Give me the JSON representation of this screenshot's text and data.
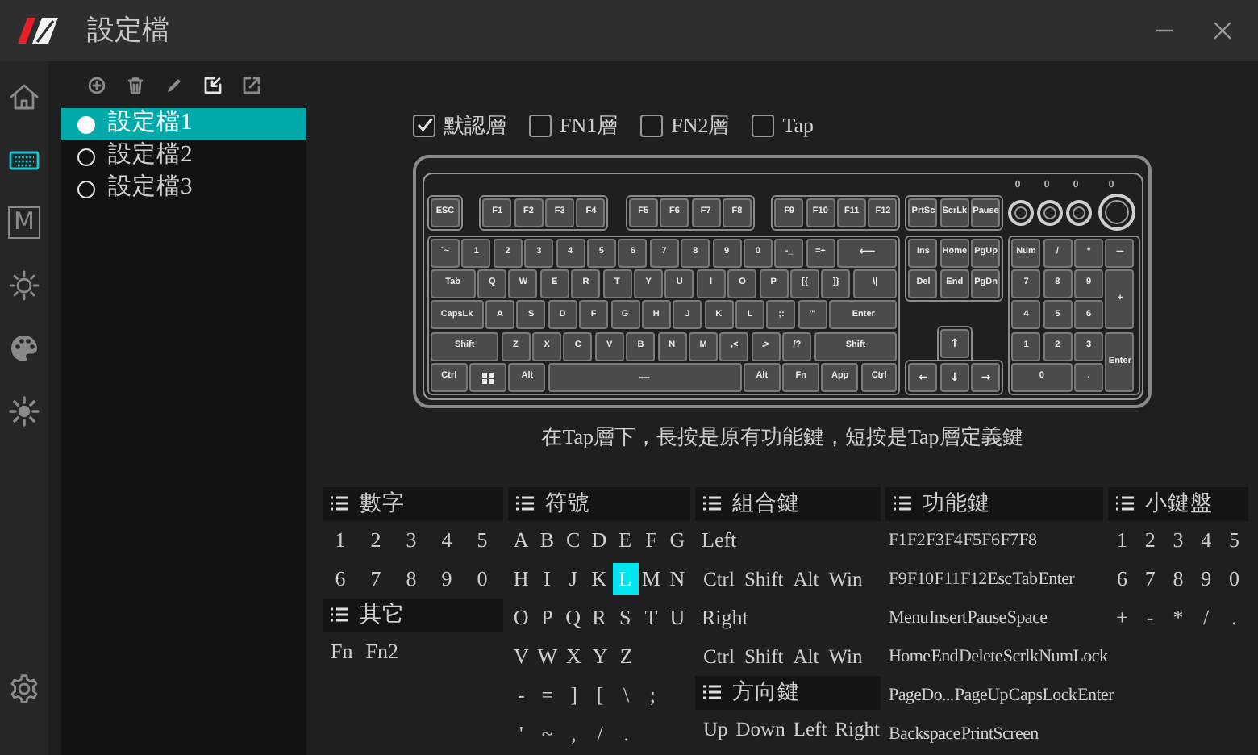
{
  "window": {
    "title": "設定檔"
  },
  "sidebar": {
    "items": [
      {
        "selected": false
      },
      {
        "selected": true
      },
      {
        "glyph": "M",
        "selected": false
      },
      {
        "selected": false
      },
      {
        "selected": false
      },
      {
        "selected": false
      },
      {
        "selected": false
      }
    ]
  },
  "profiles": [
    {
      "label": "設定檔1",
      "selected": true
    },
    {
      "label": "設定檔2",
      "selected": false
    },
    {
      "label": "設定檔3",
      "selected": false
    }
  ],
  "layers": [
    {
      "label": "默認層",
      "checked": true
    },
    {
      "label": "FN1層",
      "checked": false
    },
    {
      "label": "FN2層",
      "checked": false
    },
    {
      "label": "Tap",
      "checked": false
    }
  ],
  "keyboard": {
    "knob_readings": [
      "0",
      "0",
      "0",
      "0"
    ],
    "function_row": [
      [
        "ESC"
      ],
      [
        "F1",
        "F2",
        "F3",
        "F4"
      ],
      [
        "F5",
        "F6",
        "F7",
        "F8"
      ],
      [
        "F9",
        "F10",
        "F11",
        "F12"
      ]
    ],
    "nav_top": [
      "PrtSc",
      "ScrLk",
      "Pause"
    ],
    "main_rows": [
      [
        "`~",
        "1",
        "2",
        "3",
        "4",
        "5",
        "6",
        "7",
        "8",
        "9",
        "0",
        "-_",
        "=+",
        "⟵"
      ],
      [
        "Tab",
        "Q",
        "W",
        "E",
        "R",
        "T",
        "Y",
        "U",
        "I",
        "O",
        "P",
        "[{",
        "]}",
        "\\|"
      ],
      [
        "CapsLk",
        "A",
        "S",
        "D",
        "F",
        "G",
        "H",
        "J",
        "K",
        "L",
        ";:",
        "'\"",
        "Enter"
      ],
      [
        "Shift",
        "Z",
        "X",
        "C",
        "V",
        "B",
        "N",
        "M",
        ",<",
        ".>",
        "/?",
        "Shift"
      ],
      [
        "Ctrl",
        {
          "kind": "logo"
        },
        "Alt",
        "—",
        "Alt",
        "Fn",
        "App",
        "Ctrl"
      ]
    ],
    "nav": [
      [
        "Ins",
        "Home",
        "PgUp"
      ],
      [
        "Del",
        "End",
        "PgDn"
      ]
    ],
    "arrows": [
      "↑",
      "←",
      "↓",
      "→"
    ],
    "numpad": [
      "Num",
      "/",
      "*",
      "−",
      "7",
      "8",
      "9",
      "+",
      "4",
      "5",
      "6",
      "1",
      "2",
      "3",
      "Enter",
      "0",
      "."
    ]
  },
  "hint": "在Tap層下，長按是原有功能鍵，短按是Tap層定義鍵",
  "palettes": [
    {
      "title": "數字",
      "rows": [
        {
          "kind": "keys",
          "items": [
            {
              "label": "1",
              "selected": false
            },
            {
              "label": "2",
              "selected": false
            },
            {
              "label": "3",
              "selected": false
            },
            {
              "label": "4",
              "selected": false
            },
            {
              "label": "5",
              "selected": false
            }
          ]
        },
        {
          "kind": "keys",
          "items": [
            {
              "label": "6",
              "selected": false
            },
            {
              "label": "7",
              "selected": false
            },
            {
              "label": "8",
              "selected": false
            },
            {
              "label": "9",
              "selected": false
            },
            {
              "label": "0",
              "selected": false
            }
          ]
        }
      ]
    },
    {
      "title": "其它",
      "rows": [
        {
          "kind": "keys",
          "items": [
            {
              "label": "Fn",
              "selected": false
            },
            {
              "label": "Fn2",
              "selected": false
            }
          ]
        }
      ]
    },
    {
      "title": "符號",
      "rows": [
        {
          "kind": "keys",
          "items": [
            {
              "label": "A",
              "selected": false
            },
            {
              "label": "B",
              "selected": false
            },
            {
              "label": "C",
              "selected": false
            },
            {
              "label": "D",
              "selected": false
            },
            {
              "label": "E",
              "selected": false
            },
            {
              "label": "F",
              "selected": false
            },
            {
              "label": "G",
              "selected": false
            }
          ]
        },
        {
          "kind": "keys",
          "items": [
            {
              "label": "H",
              "selected": false
            },
            {
              "label": "I",
              "selected": false
            },
            {
              "label": "J",
              "selected": false
            },
            {
              "label": "K",
              "selected": false
            },
            {
              "label": "L",
              "selected": true
            },
            {
              "label": "M",
              "selected": false
            },
            {
              "label": "N",
              "selected": false
            }
          ]
        },
        {
          "kind": "keys",
          "items": [
            {
              "label": "O",
              "selected": false
            },
            {
              "label": "P",
              "selected": false
            },
            {
              "label": "Q",
              "selected": false
            },
            {
              "label": "R",
              "selected": false
            },
            {
              "label": "S",
              "selected": false
            },
            {
              "label": "T",
              "selected": false
            },
            {
              "label": "U",
              "selected": false
            }
          ]
        },
        {
          "kind": "keys",
          "items": [
            {
              "label": "V",
              "selected": false
            },
            {
              "label": "W",
              "selected": false
            },
            {
              "label": "X",
              "selected": false
            },
            {
              "label": "Y",
              "selected": false
            },
            {
              "label": "Z",
              "selected": false
            }
          ]
        },
        {
          "kind": "keys",
          "items": [
            {
              "label": "-",
              "selected": false
            },
            {
              "label": "=",
              "selected": false
            },
            {
              "label": "]",
              "selected": false
            },
            {
              "label": "[",
              "selected": false
            },
            {
              "label": "\\",
              "selected": false
            },
            {
              "label": ";",
              "selected": false
            }
          ]
        },
        {
          "kind": "keys",
          "items": [
            {
              "label": "'",
              "selected": false
            },
            {
              "label": "~",
              "selected": false
            },
            {
              "label": ",",
              "selected": false
            },
            {
              "label": "/",
              "selected": false
            },
            {
              "label": ".",
              "selected": false
            }
          ]
        }
      ]
    },
    {
      "title": "組合鍵",
      "rows": [
        {
          "kind": "heading",
          "label": "Left"
        },
        {
          "kind": "keys",
          "items": [
            {
              "label": "Ctrl",
              "selected": false
            },
            {
              "label": "Shift",
              "selected": false
            },
            {
              "label": "Alt",
              "selected": false
            },
            {
              "label": "Win",
              "selected": false
            }
          ]
        },
        {
          "kind": "heading",
          "label": "Right"
        },
        {
          "kind": "keys",
          "items": [
            {
              "label": "Ctrl",
              "selected": false
            },
            {
              "label": "Shift",
              "selected": false
            },
            {
              "label": "Alt",
              "selected": false
            },
            {
              "label": "Win",
              "selected": false
            }
          ]
        }
      ]
    },
    {
      "title": "方向鍵",
      "rows": [
        {
          "kind": "keys",
          "items": [
            {
              "label": "Up",
              "selected": false
            },
            {
              "label": "Down",
              "selected": false
            },
            {
              "label": "Left",
              "selected": false
            },
            {
              "label": "Right",
              "selected": false
            }
          ]
        }
      ]
    },
    {
      "title": "功能鍵",
      "rows": [
        {
          "kind": "keys",
          "items": [
            {
              "label": "F1",
              "selected": false
            },
            {
              "label": "F2",
              "selected": false
            },
            {
              "label": "F3",
              "selected": false
            },
            {
              "label": "F4",
              "selected": false
            },
            {
              "label": "F5",
              "selected": false
            },
            {
              "label": "F6",
              "selected": false
            },
            {
              "label": "F7",
              "selected": false
            },
            {
              "label": "F8",
              "selected": false
            }
          ]
        },
        {
          "kind": "keys",
          "items": [
            {
              "label": "F9",
              "selected": false
            },
            {
              "label": "F10",
              "selected": false
            },
            {
              "label": "F11",
              "selected": false
            },
            {
              "label": "F12",
              "selected": false
            },
            {
              "label": "Esc",
              "selected": false
            },
            {
              "label": "Tab",
              "selected": false
            },
            {
              "label": "Enter",
              "selected": false
            }
          ]
        },
        {
          "kind": "keys",
          "items": [
            {
              "label": "Menu",
              "selected": false
            },
            {
              "label": "Insert",
              "selected": false
            },
            {
              "label": "Pause",
              "selected": false
            },
            {
              "label": "Space",
              "selected": false
            }
          ]
        },
        {
          "kind": "keys",
          "items": [
            {
              "label": "Home",
              "selected": false
            },
            {
              "label": "End",
              "selected": false
            },
            {
              "label": "Delete",
              "selected": false
            },
            {
              "label": "Scrlk",
              "selected": false
            },
            {
              "label": "NumLock",
              "selected": false
            }
          ]
        },
        {
          "kind": "keys",
          "items": [
            {
              "label": "PageDo...",
              "selected": false
            },
            {
              "label": "PageUp",
              "selected": false
            },
            {
              "label": "CapsLock",
              "selected": false
            },
            {
              "label": "Enter",
              "selected": false
            }
          ]
        },
        {
          "kind": "keys",
          "items": [
            {
              "label": "Backspace",
              "selected": false
            },
            {
              "label": "PrintScreen",
              "selected": false
            }
          ]
        }
      ]
    },
    {
      "title": "小鍵盤",
      "rows": [
        {
          "kind": "keys",
          "items": [
            {
              "label": "1",
              "selected": false
            },
            {
              "label": "2",
              "selected": false
            },
            {
              "label": "3",
              "selected": false
            },
            {
              "label": "4",
              "selected": false
            },
            {
              "label": "5",
              "selected": false
            }
          ]
        },
        {
          "kind": "keys",
          "items": [
            {
              "label": "6",
              "selected": false
            },
            {
              "label": "7",
              "selected": false
            },
            {
              "label": "8",
              "selected": false
            },
            {
              "label": "9",
              "selected": false
            },
            {
              "label": "0",
              "selected": false
            }
          ]
        },
        {
          "kind": "keys",
          "items": [
            {
              "label": "+",
              "selected": false
            },
            {
              "label": "-",
              "selected": false
            },
            {
              "label": "*",
              "selected": false
            },
            {
              "label": "/",
              "selected": false
            },
            {
              "label": ".",
              "selected": false
            }
          ]
        }
      ]
    }
  ]
}
